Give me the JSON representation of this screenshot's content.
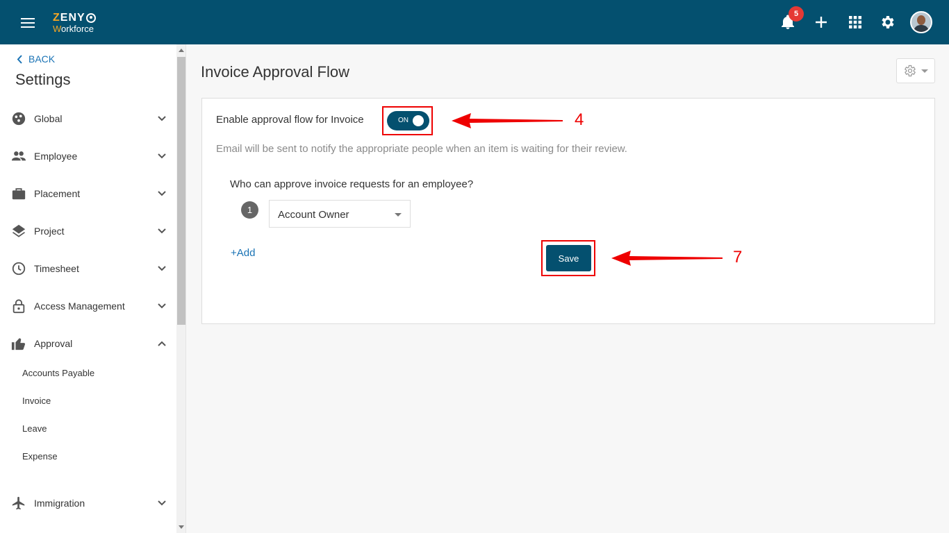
{
  "header": {
    "logo_top": "ZENY",
    "logo_bottom": "Workforce",
    "notification_count": "5",
    "brand_color": "#04506f",
    "icons": [
      "menu-icon",
      "bell-icon",
      "plus-icon",
      "apps-grid-icon",
      "gear-icon",
      "avatar"
    ]
  },
  "sidebar": {
    "back_label": "BACK",
    "title": "Settings",
    "items": [
      {
        "label": "Global",
        "icon": "palette-icon"
      },
      {
        "label": "Employee",
        "icon": "people-icon"
      },
      {
        "label": "Placement",
        "icon": "briefcase-icon"
      },
      {
        "label": "Project",
        "icon": "layers-icon"
      },
      {
        "label": "Timesheet",
        "icon": "clock-icon"
      },
      {
        "label": "Access Management",
        "icon": "lock-icon"
      },
      {
        "label": "Approval",
        "icon": "thumbs-up-icon",
        "expanded": true
      },
      {
        "label": "Immigration",
        "icon": "airplane-icon"
      }
    ],
    "approval_sub_items": [
      "Accounts Payable",
      "Invoice",
      "Leave",
      "Expense"
    ]
  },
  "main": {
    "title": "Invoice Approval Flow",
    "enable_label": "Enable approval flow for Invoice",
    "toggle_label": "ON",
    "note": "Email will be sent to notify the appropriate people when an item is waiting for their review.",
    "question": "Who can approve invoice requests for an employee?",
    "approver_steps": [
      {
        "number": "1",
        "selected": "Account Owner"
      }
    ],
    "add_label": "+Add",
    "save_label": "Save"
  },
  "annotations": {
    "toggle_step": "4",
    "save_step": "7",
    "color": "#ee0000"
  }
}
